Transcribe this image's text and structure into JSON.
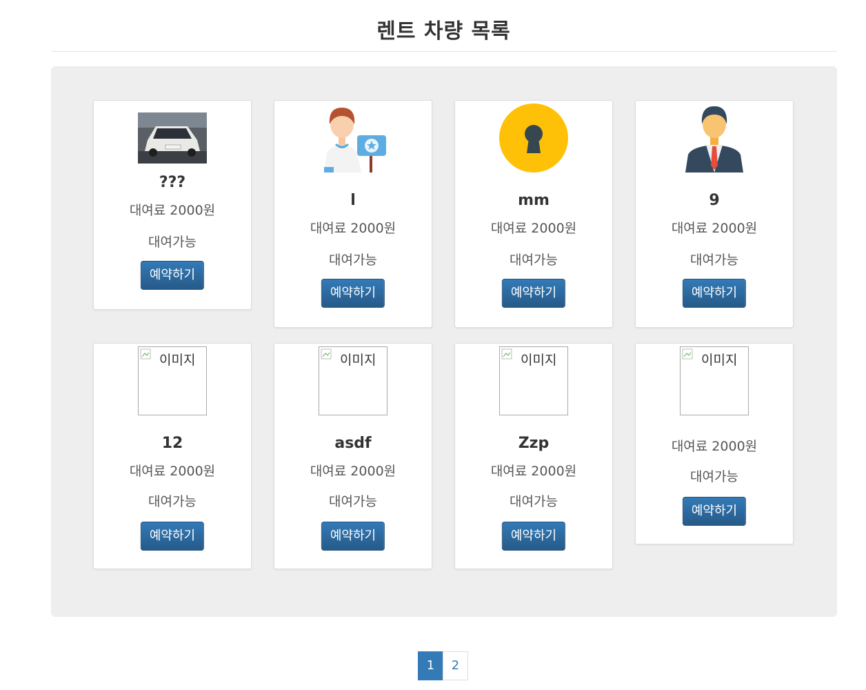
{
  "header": {
    "title": "렌트 차량 목록"
  },
  "cars": [
    {
      "name": "???",
      "fee": "대여료 2000원",
      "status": "대여가능",
      "button": "예약하기",
      "image": "car-photo"
    },
    {
      "name": "l",
      "fee": "대여료 2000원",
      "status": "대여가능",
      "button": "예약하기",
      "image": "person-with-sign-icon"
    },
    {
      "name": "mm",
      "fee": "대여료 2000원",
      "status": "대여가능",
      "button": "예약하기",
      "image": "keyhole-icon"
    },
    {
      "name": "9",
      "fee": "대여료 2000원",
      "status": "대여가능",
      "button": "예약하기",
      "image": "businessman-icon"
    },
    {
      "name": "12",
      "fee": "대여료 2000원",
      "status": "대여가능",
      "button": "예약하기",
      "image": "broken-image",
      "alt": "이미지"
    },
    {
      "name": "asdf",
      "fee": "대여료 2000원",
      "status": "대여가능",
      "button": "예약하기",
      "image": "broken-image",
      "alt": "이미지"
    },
    {
      "name": "Zzp",
      "fee": "대여료 2000원",
      "status": "대여가능",
      "button": "예약하기",
      "image": "broken-image",
      "alt": "이미지"
    },
    {
      "name": "",
      "fee": "대여료 2000원",
      "status": "대여가능",
      "button": "예약하기",
      "image": "broken-image",
      "alt": "이미지"
    }
  ],
  "pagination": {
    "pages": [
      "1",
      "2"
    ],
    "current": "1"
  },
  "colors": {
    "primary": "#337ab7",
    "jumbotron": "#eeeeee",
    "keyhole_bg": "#ffc107"
  }
}
